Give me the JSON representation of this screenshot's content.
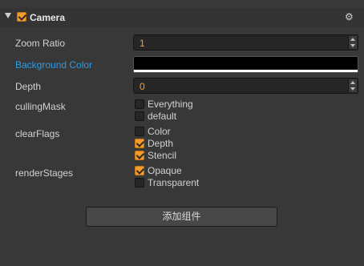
{
  "component": {
    "title": "Camera",
    "enabled": true,
    "collapse_icon": "triangle-down-icon",
    "settings_icon": "gear-icon"
  },
  "props": {
    "zoom_ratio": {
      "label": "Zoom Ratio",
      "value": "1"
    },
    "background_color": {
      "label": "Background Color",
      "color": "#000000"
    },
    "depth": {
      "label": "Depth",
      "value": "0"
    },
    "culling_mask": {
      "label": "cullingMask",
      "options": [
        {
          "label": "Everything",
          "checked": false
        },
        {
          "label": "default",
          "checked": false
        }
      ]
    },
    "clear_flags": {
      "label": "clearFlags",
      "options": [
        {
          "label": "Color",
          "checked": false
        },
        {
          "label": "Depth",
          "checked": true
        },
        {
          "label": "Stencil",
          "checked": true
        }
      ]
    },
    "render_stages": {
      "label": "renderStages",
      "options": [
        {
          "label": "Opaque",
          "checked": true
        },
        {
          "label": "Transparent",
          "checked": false
        }
      ]
    }
  },
  "add_component_label": "添加组件",
  "colors": {
    "accent": "#f39c2a",
    "highlight_label": "#2e9be6",
    "panel_bg": "#383838"
  }
}
